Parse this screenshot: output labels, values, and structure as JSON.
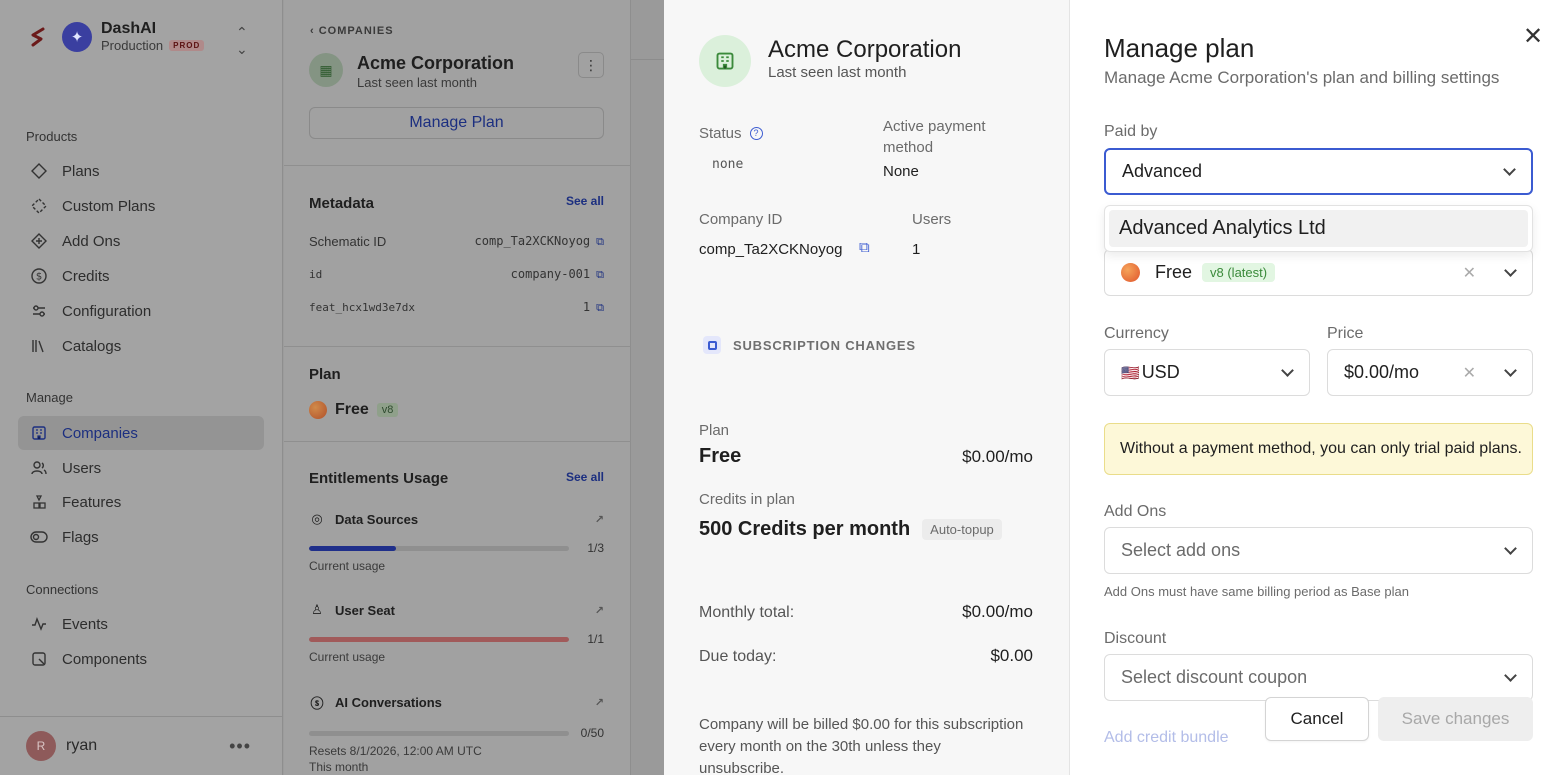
{
  "sidebar": {
    "brand_name": "DashAI",
    "environment": "Production",
    "env_badge": "PROD",
    "sections": {
      "products": "Products",
      "manage": "Manage",
      "connections": "Connections"
    },
    "products": [
      {
        "label": "Plans",
        "icon": "diamond-icon"
      },
      {
        "label": "Custom Plans",
        "icon": "custom-diamond-icon"
      },
      {
        "label": "Add Ons",
        "icon": "addon-icon"
      },
      {
        "label": "Credits",
        "icon": "dollar-circle-icon"
      },
      {
        "label": "Configuration",
        "icon": "sliders-icon"
      },
      {
        "label": "Catalogs",
        "icon": "library-icon"
      }
    ],
    "manage": [
      {
        "label": "Companies",
        "icon": "building-icon",
        "active": true
      },
      {
        "label": "Users",
        "icon": "users-icon"
      },
      {
        "label": "Features",
        "icon": "features-icon"
      },
      {
        "label": "Flags",
        "icon": "toggle-icon"
      }
    ],
    "connections": [
      {
        "label": "Events",
        "icon": "activity-icon"
      },
      {
        "label": "Components",
        "icon": "component-icon"
      }
    ],
    "user": {
      "initial": "R",
      "name": "ryan"
    }
  },
  "detail": {
    "back_label": "COMPANIES",
    "company_name": "Acme Corporation",
    "last_seen": "Last seen last month",
    "manage_plan_button": "Manage Plan",
    "metadata_title": "Metadata",
    "see_all": "See all",
    "metadata": [
      {
        "key": "Schematic ID",
        "value": "comp_Ta2XCKNoyog"
      },
      {
        "key": "id",
        "value": "company-001"
      },
      {
        "key": "feat_hcx1wd3e7dx",
        "value": "1"
      }
    ],
    "plan_title": "Plan",
    "plan_name": "Free",
    "plan_version": "v8",
    "entitlements_title": "Entitlements Usage",
    "entitlements": [
      {
        "name": "Data Sources",
        "usage": "1/3",
        "fraction": 0.333,
        "sub": "Current usage",
        "color": "#1f2f8a"
      },
      {
        "name": "User Seat",
        "usage": "1/1",
        "fraction": 1.0,
        "sub": "Current usage",
        "color": "#a15a5a"
      },
      {
        "name": "AI Conversations",
        "usage": "0/50",
        "fraction": 0.0,
        "sub": "Resets 8/1/2026, 12:00 AM UTC",
        "sub2": "This month",
        "color": "#1f2f8a"
      }
    ]
  },
  "summary": {
    "company_name": "Acme Corporation",
    "last_seen": "Last seen last month",
    "status_label": "Status",
    "status_value": "none",
    "payment_label": "Active payment method",
    "payment_value": "None",
    "company_id_label": "Company ID",
    "company_id_value": "comp_Ta2XCKNoyog",
    "users_label": "Users",
    "users_value": "1",
    "subscription_changes": "SUBSCRIPTION CHANGES",
    "plan_label": "Plan",
    "plan_name": "Free",
    "plan_price": "$0.00/mo",
    "credits_label": "Credits in plan",
    "credits_value": "500 Credits per month",
    "auto_topup": "Auto-topup",
    "monthly_total_label": "Monthly total:",
    "monthly_total_value": "$0.00/mo",
    "due_today_label": "Due today:",
    "due_today_value": "$0.00",
    "billing_note": "Company will be billed $0.00 for this subscription every month on the 30th unless they unsubscribe."
  },
  "manage_plan": {
    "title": "Manage plan",
    "subtitle": "Manage Acme Corporation's plan and billing settings",
    "paid_by_label": "Paid by",
    "paid_by_value": "Advanced",
    "dropdown_options": [
      "Advanced Analytics Ltd"
    ],
    "plan_value": "Free",
    "plan_version": "v8 (latest)",
    "currency_label": "Currency",
    "currency_flag": "🇺🇸",
    "currency_value": "USD",
    "price_label": "Price",
    "price_value": "$0.00/mo",
    "warning": "Without a payment method, you can only trial paid plans.",
    "addons_label": "Add Ons",
    "addons_placeholder": "Select add ons",
    "addons_hint": "Add Ons must have same billing period as Base plan",
    "discount_label": "Discount",
    "discount_placeholder": "Select discount coupon",
    "add_credit_bundle": "Add credit bundle",
    "cancel_button": "Cancel",
    "save_button": "Save changes"
  }
}
